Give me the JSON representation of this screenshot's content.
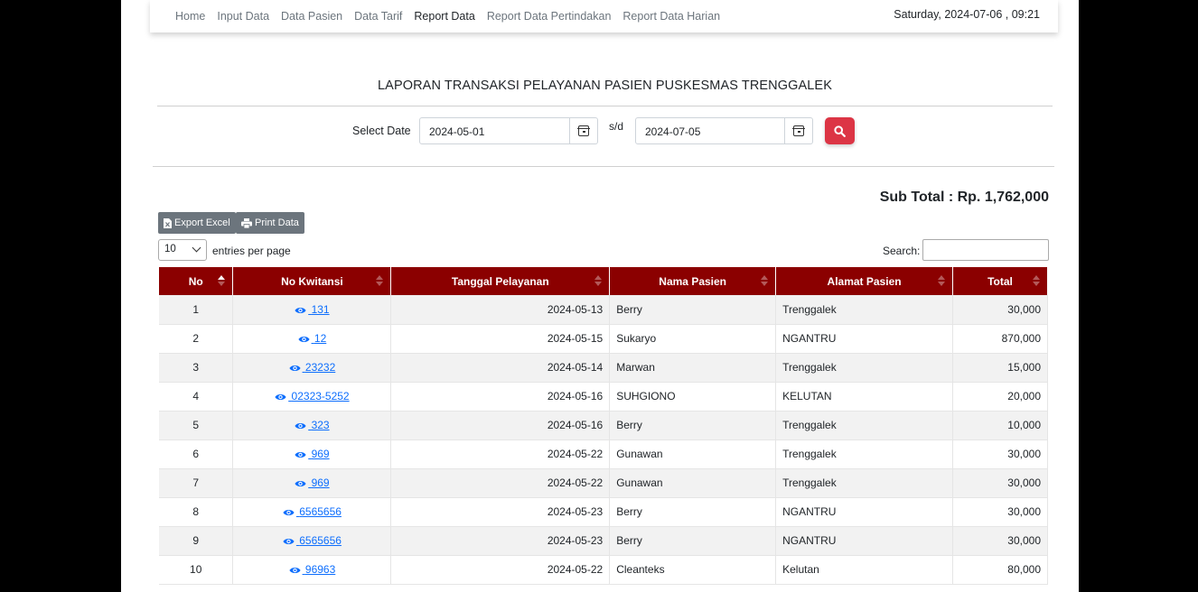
{
  "nav": {
    "items": [
      "Home",
      "Input Data",
      "Data Pasien",
      "Data Tarif",
      "Report Data",
      "Report Data Pertindakan",
      "Report Data Harian"
    ],
    "active": "Report Data",
    "datetime": "Saturday, 2024-07-06 , 09:21"
  },
  "report": {
    "title": "LAPORAN TRANSAKSI PELAYANAN PASIEN PUSKESMAS TRENGGALEK",
    "select_label": "Select Date",
    "date_from": "2024-05-01",
    "sd_label": "s/d",
    "date_to": "2024-07-05",
    "subtotal": "Sub Total : Rp. 1,762,000"
  },
  "toolbar": {
    "export_label": "Export Excel",
    "print_label": "Print Data",
    "entries_value": "10",
    "entries_label": "entries per page",
    "search_label": "Search:",
    "search_value": ""
  },
  "table": {
    "headers": [
      "No",
      "No Kwitansi",
      "Tanggal Pelayanan",
      "Nama Pasien",
      "Alamat Pasien",
      "Total"
    ],
    "rows": [
      {
        "no": "1",
        "kwitansi": "131",
        "tanggal": "2024-05-13",
        "nama": "Berry",
        "alamat": "Trenggalek",
        "total": "30,000"
      },
      {
        "no": "2",
        "kwitansi": "12",
        "tanggal": "2024-05-15",
        "nama": "Sukaryo",
        "alamat": "NGANTRU",
        "total": "870,000"
      },
      {
        "no": "3",
        "kwitansi": "23232",
        "tanggal": "2024-05-14",
        "nama": "Marwan",
        "alamat": "Trenggalek",
        "total": "15,000"
      },
      {
        "no": "4",
        "kwitansi": "02323-5252",
        "tanggal": "2024-05-16",
        "nama": "SUHGIONO",
        "alamat": "KELUTAN",
        "total": "20,000"
      },
      {
        "no": "5",
        "kwitansi": "323",
        "tanggal": "2024-05-16",
        "nama": "Berry",
        "alamat": "Trenggalek",
        "total": "10,000"
      },
      {
        "no": "6",
        "kwitansi": "969",
        "tanggal": "2024-05-22",
        "nama": "Gunawan",
        "alamat": "Trenggalek",
        "total": "30,000"
      },
      {
        "no": "7",
        "kwitansi": "969",
        "tanggal": "2024-05-22",
        "nama": "Gunawan",
        "alamat": "Trenggalek",
        "total": "30,000"
      },
      {
        "no": "8",
        "kwitansi": "6565656",
        "tanggal": "2024-05-23",
        "nama": "Berry",
        "alamat": "NGANTRU",
        "total": "30,000"
      },
      {
        "no": "9",
        "kwitansi": "6565656",
        "tanggal": "2024-05-23",
        "nama": "Berry",
        "alamat": "NGANTRU",
        "total": "30,000"
      },
      {
        "no": "10",
        "kwitansi": "96963",
        "tanggal": "2024-05-22",
        "nama": "Cleanteks",
        "alamat": "Kelutan",
        "total": "80,000"
      }
    ]
  },
  "colors": {
    "header_bg": "#8b0000",
    "search_button": "#dc3545",
    "link": "#0d6efd",
    "button_gray": "#6c757d"
  }
}
